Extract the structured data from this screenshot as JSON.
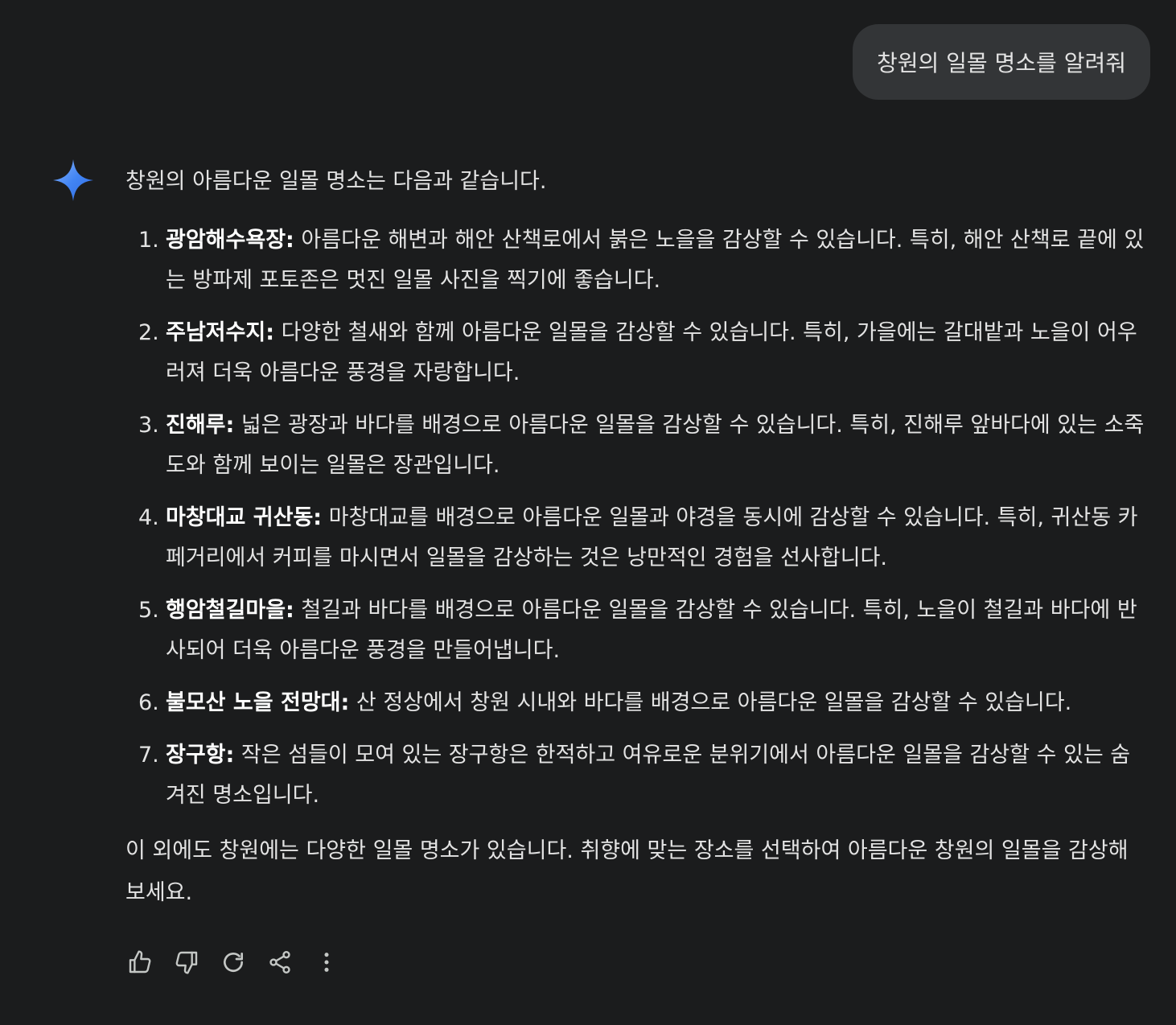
{
  "user_message": "창원의 일몰 명소를 알려줘",
  "response": {
    "intro": "창원의 아름다운 일몰 명소는 다음과 같습니다.",
    "items": [
      {
        "num": "1.",
        "title": "광암해수욕장:",
        "text": " 아름다운 해변과 해안 산책로에서 붉은 노을을 감상할 수 있습니다. 특히, 해안 산책로 끝에 있는 방파제 포토존은 멋진 일몰 사진을 찍기에 좋습니다."
      },
      {
        "num": "2.",
        "title": "주남저수지:",
        "text": " 다양한 철새와 함께 아름다운 일몰을 감상할 수 있습니다. 특히, 가을에는 갈대밭과 노을이 어우러져 더욱 아름다운 풍경을 자랑합니다."
      },
      {
        "num": "3.",
        "title": "진해루:",
        "text": " 넓은 광장과 바다를 배경으로 아름다운 일몰을 감상할 수 있습니다. 특히, 진해루 앞바다에 있는 소죽도와 함께 보이는 일몰은 장관입니다."
      },
      {
        "num": "4.",
        "title": "마창대교 귀산동:",
        "text": " 마창대교를 배경으로 아름다운 일몰과 야경을 동시에 감상할 수 있습니다. 특히, 귀산동 카페거리에서 커피를 마시면서 일몰을 감상하는 것은 낭만적인 경험을 선사합니다."
      },
      {
        "num": "5.",
        "title": "행암철길마을:",
        "text": " 철길과 바다를 배경으로 아름다운 일몰을 감상할 수 있습니다. 특히, 노을이 철길과 바다에 반사되어 더욱 아름다운 풍경을 만들어냅니다."
      },
      {
        "num": "6.",
        "title": "불모산 노을 전망대:",
        "text": " 산 정상에서 창원 시내와 바다를 배경으로 아름다운 일몰을 감상할 수 있습니다."
      },
      {
        "num": "7.",
        "title": "장구항:",
        "text": " 작은 섬들이 모여 있는 장구항은 한적하고 여유로운 분위기에서 아름다운 일몰을 감상할 수 있는 숨겨진 명소입니다."
      }
    ],
    "outro": "이 외에도 창원에는 다양한 일몰 명소가 있습니다. 취향에 맞는 장소를 선택하여 아름다운 창원의 일몰을 감상해 보세요."
  },
  "icons": {
    "spark": "gemini-sparkle-icon",
    "actions": [
      "thumbs-up-icon",
      "thumbs-down-icon",
      "regenerate-icon",
      "share-icon",
      "more-vert-icon"
    ]
  },
  "colors": {
    "background": "#1b1c1d",
    "bubble": "#333537",
    "text": "#e3e3e3",
    "spark_start": "#4285f4",
    "spark_end": "#7baaf7"
  }
}
